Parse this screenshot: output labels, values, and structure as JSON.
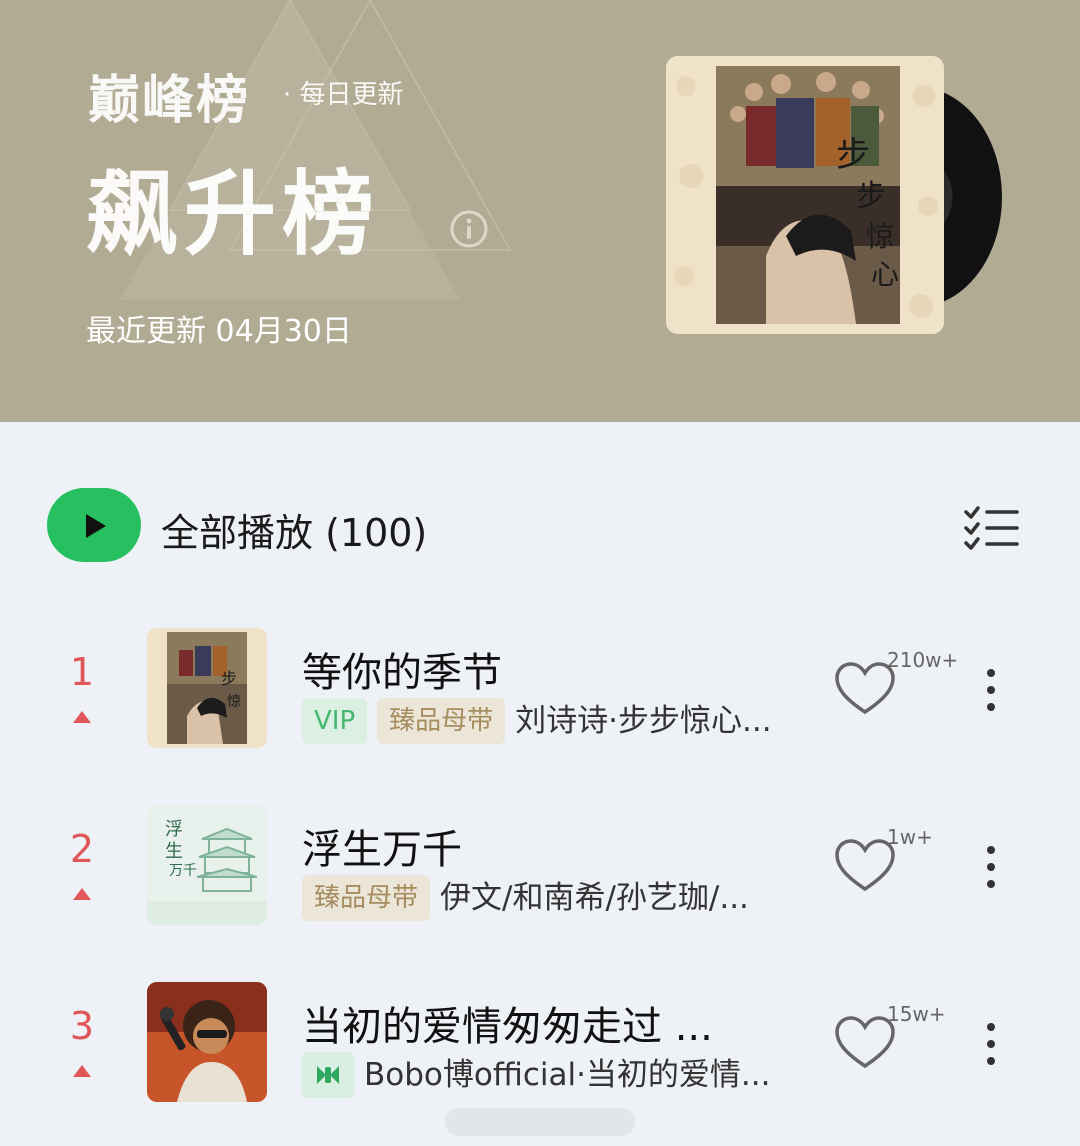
{
  "header": {
    "brand": "巅峰榜",
    "brand_sub": "· 每日更新",
    "title": "飙升榜",
    "updated": "最近更新 04月30日",
    "accent_color": "#b2ab94"
  },
  "play_all": {
    "label": "全部播放 (100)",
    "button_color": "#27c060"
  },
  "songs": [
    {
      "rank": "1",
      "trend": "up",
      "title": "等你的季节",
      "tags": [
        "VIP",
        "臻品母带"
      ],
      "artist": "刘诗诗·步步惊心...",
      "likes": "210w+"
    },
    {
      "rank": "2",
      "trend": "up",
      "title": "浮生万千",
      "tags": [
        "臻品母带"
      ],
      "artist": "伊文/和南希/孙艺珈/...",
      "likes": "1w+"
    },
    {
      "rank": "3",
      "trend": "up",
      "title": "当初的爱情匆匆走过 ...",
      "tags": [
        "mv-icon"
      ],
      "artist": "Bobo博official·当初的爱情...",
      "likes": "15w+"
    }
  ]
}
